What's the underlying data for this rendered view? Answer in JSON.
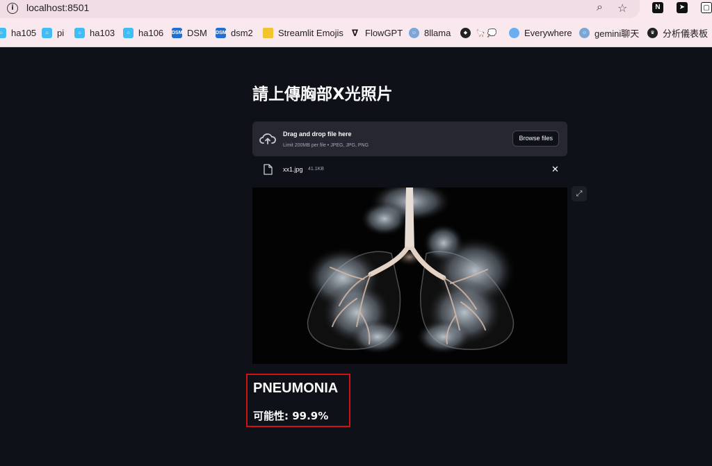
{
  "browser": {
    "url": "localhost:8501",
    "bookmarks": [
      {
        "label": "ha105",
        "icon": "home-assistant-icon"
      },
      {
        "label": "pi",
        "icon": "home-assistant-icon"
      },
      {
        "label": "ha103",
        "icon": "home-assistant-icon"
      },
      {
        "label": "ha106",
        "icon": "home-assistant-icon"
      },
      {
        "label": "DSM",
        "icon": "dsm-icon"
      },
      {
        "label": "dsm2",
        "icon": "dsm-icon"
      },
      {
        "label": "Streamlit Emojis",
        "icon": "folder-icon"
      },
      {
        "label": "FlowGPT",
        "icon": "flowgpt-icon"
      },
      {
        "label": "8llama",
        "icon": "robot-icon"
      },
      {
        "label": "",
        "icon": "llama-icon"
      },
      {
        "label": "Everywhere",
        "icon": "chat-bubble-icon"
      },
      {
        "label": "gemini聊天",
        "icon": "robot-icon"
      },
      {
        "label": "分析儀表板",
        "icon": "dashboard-icon"
      }
    ]
  },
  "page": {
    "title": "請上傳胸部X光照片"
  },
  "uploader": {
    "drop_text": "Drag and drop file here",
    "limit_text": "Limit 200MB per file • JPEG, JPG, PNG",
    "browse_label": "Browse files"
  },
  "file": {
    "name": "xx1.jpg",
    "size": "41.1KB"
  },
  "result": {
    "label": "PNEUMONIA",
    "probability_text": "可能性: 99.9%",
    "probability": 0.999
  },
  "colors": {
    "background": "#0e1117",
    "uploader_bg": "#262730",
    "highlight_border": "#d11212"
  }
}
